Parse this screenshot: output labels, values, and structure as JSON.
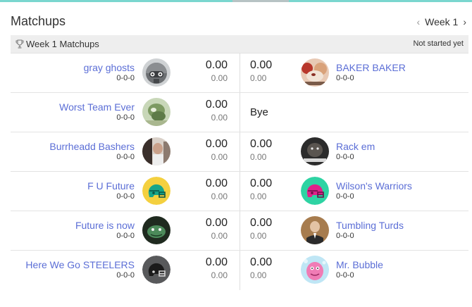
{
  "section": {
    "title": "Matchups"
  },
  "week_nav": {
    "label": "Week 1",
    "prev_icon": "chevron-left-icon",
    "next_icon": "chevron-right-icon"
  },
  "week_header": {
    "icon": "trophy-icon",
    "title": "Week 1 Matchups",
    "status": "Not started yet"
  },
  "colors": {
    "link": "#5b6ed6",
    "header_bg": "#eeeeee",
    "accent_bar": "#7ad6cf"
  },
  "matchups": [
    {
      "home": {
        "name": "gray ghosts",
        "record": "0-0-0",
        "score": "0.00",
        "projected": "0.00"
      },
      "away": {
        "name": "BAKER BAKER",
        "record": "0-0-0",
        "score": "0.00",
        "projected": "0.00"
      }
    },
    {
      "home": {
        "name": "Worst Team Ever",
        "record": "0-0-0",
        "score": "0.00",
        "projected": "0.00"
      },
      "bye_label": "Bye"
    },
    {
      "home": {
        "name": "Burrheadd Bashers",
        "record": "0-0-0",
        "score": "0.00",
        "projected": "0.00"
      },
      "away": {
        "name": "Rack em",
        "record": "0-0-0",
        "score": "0.00",
        "projected": "0.00"
      }
    },
    {
      "home": {
        "name": "F U Future",
        "record": "0-0-0",
        "score": "0.00",
        "projected": "0.00"
      },
      "away": {
        "name": "Wilson's Warriors",
        "record": "0-0-0",
        "score": "0.00",
        "projected": "0.00"
      }
    },
    {
      "home": {
        "name": "Future is now",
        "record": "0-0-0",
        "score": "0.00",
        "projected": "0.00"
      },
      "away": {
        "name": "Tumbling Turds",
        "record": "0-0-0",
        "score": "0.00",
        "projected": "0.00"
      }
    },
    {
      "home": {
        "name": "Here We Go STEELERS",
        "record": "0-0-0",
        "score": "0.00",
        "projected": "0.00"
      },
      "away": {
        "name": "Mr. Bubble",
        "record": "0-0-0",
        "score": "0.00",
        "projected": "0.00"
      }
    }
  ]
}
